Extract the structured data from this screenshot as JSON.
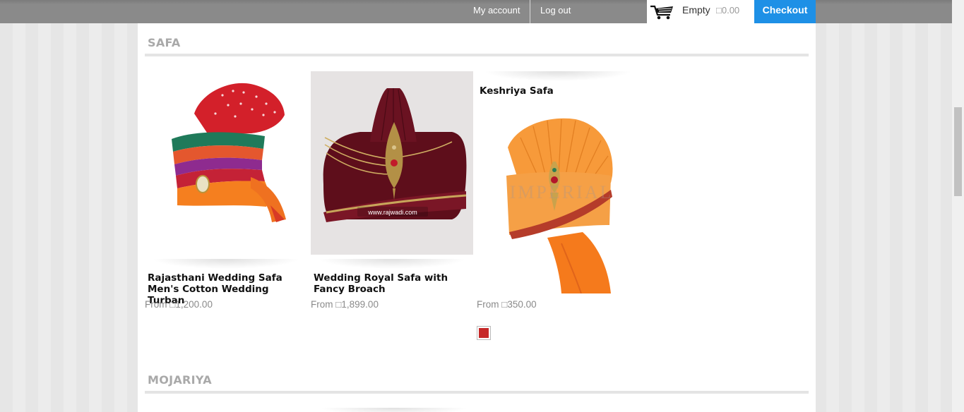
{
  "header": {
    "my_account": "My account",
    "log_out": "Log out",
    "cart": {
      "label": "Empty",
      "total": "□0.00",
      "icon": "cart-icon"
    },
    "checkout": "Checkout"
  },
  "sections": [
    {
      "title": "SAFA",
      "products": [
        {
          "name": "Rajasthani Wedding Safa Men's Cotton Wedding Turban",
          "price": "From □1,200.00"
        },
        {
          "name": "Wedding Royal Safa with Fancy Broach",
          "price": "From □1,899.00",
          "watermark": "www.rajwadi.com"
        },
        {
          "name": "Keshriya Safa",
          "price": "From □350.00",
          "watermark": "IMPERIAL",
          "swatch_color": "#c62828"
        }
      ]
    },
    {
      "title": "MOJARIYA"
    }
  ],
  "colors": {
    "accent": "#1e90e6",
    "section_title": "#a9a9a9",
    "price": "#8a8a8a"
  }
}
